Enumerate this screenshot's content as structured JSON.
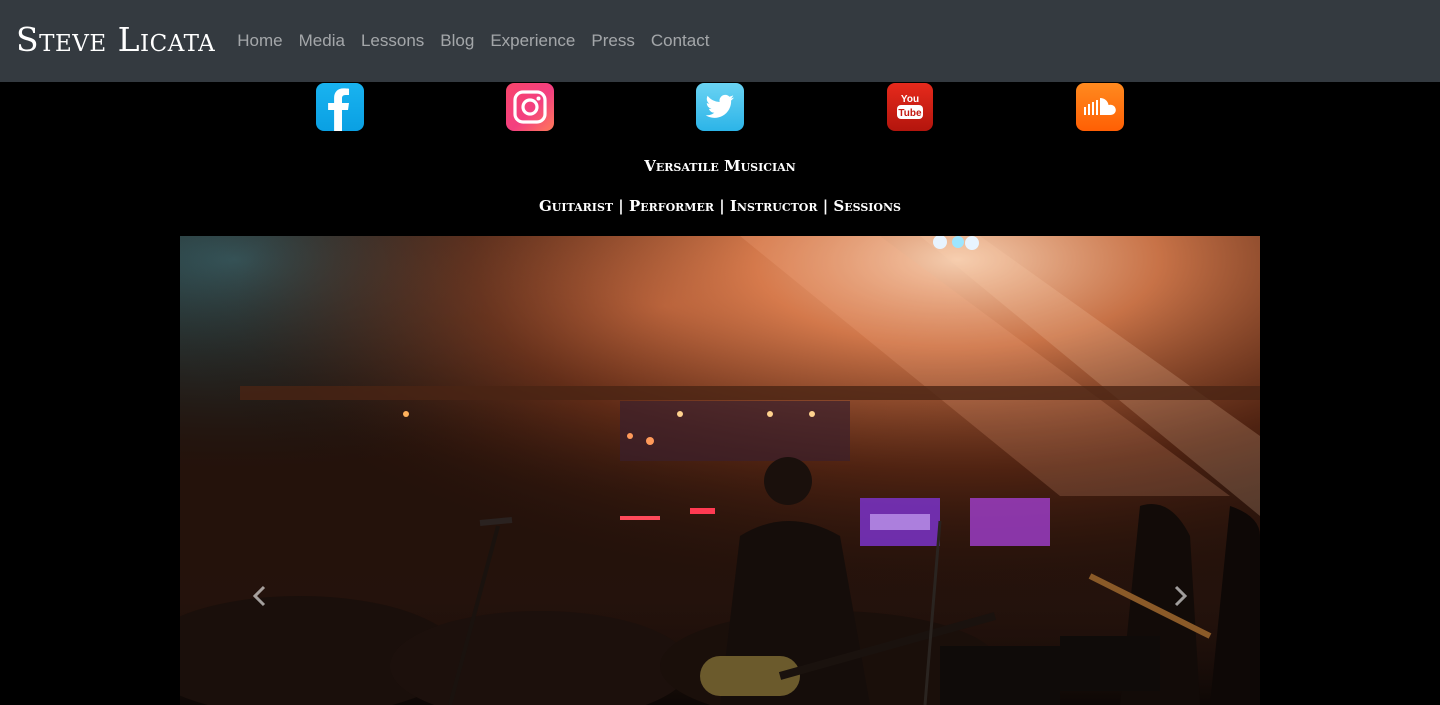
{
  "navbar": {
    "brand": "Steve Licata",
    "links": [
      "Home",
      "Media",
      "Lessons",
      "Blog",
      "Experience",
      "Press",
      "Contact"
    ]
  },
  "social": [
    {
      "icon": "facebook-icon",
      "color": "#1aa8ec"
    },
    {
      "icon": "instagram-icon",
      "color": "#f4436c"
    },
    {
      "icon": "twitter-icon",
      "color": "#45c0ee"
    },
    {
      "icon": "youtube-icon",
      "color": "#d01f14",
      "label": "You Tube"
    },
    {
      "icon": "soundcloud-icon",
      "color": "#ff6f0e"
    }
  ],
  "tagline": {
    "primary": "Versatile Musician",
    "secondary": "Guitarist | Performer | Instructor | Sessions"
  },
  "hero": {
    "prev_icon": "chevron-left-icon",
    "next_icon": "chevron-right-icon"
  },
  "colors": {
    "navbar_bg": "#343a40",
    "page_bg": "#000000",
    "nav_link": "#9a9ea3"
  }
}
